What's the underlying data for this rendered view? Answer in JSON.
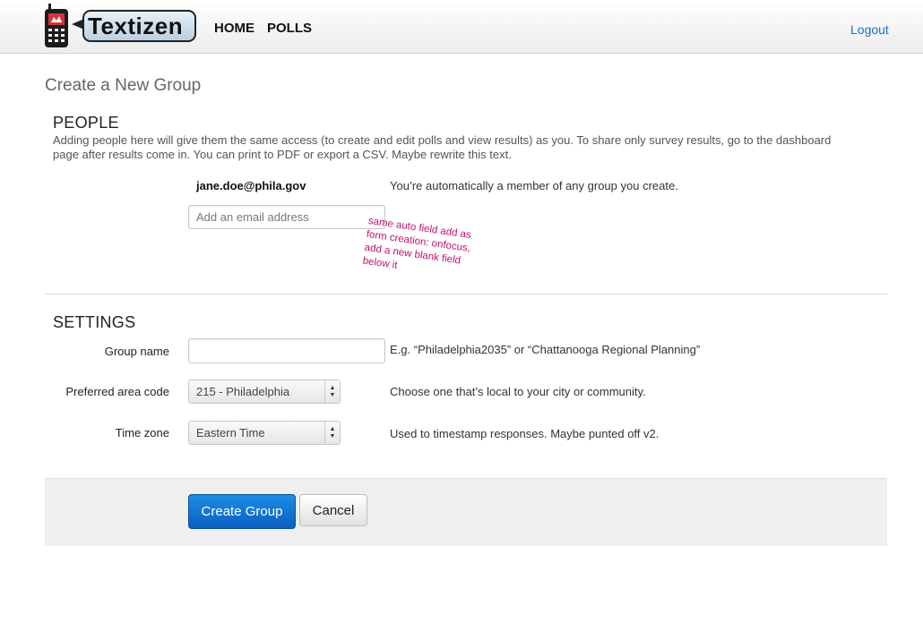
{
  "nav": {
    "brand": "Textizen",
    "home": "HOME",
    "polls": "POLLS",
    "logout": "Logout"
  },
  "page": {
    "title": "Create a New Group"
  },
  "people": {
    "heading": "PEOPLE",
    "intro": "Adding people here will give them the same access (to create and edit polls and view results) as you. To share only survey results, go to the dashboard page after results come in. You can print to PDF or export a CSV. Maybe rewrite this text.",
    "current_user": "jane.doe@phila.gov",
    "current_user_help": "You’re automatically a member of any group you create.",
    "email_placeholder": "Add an email address",
    "annotation": "same auto field add as form creation: onfocus, add a new blank field below it"
  },
  "settings": {
    "heading": "SETTINGS",
    "group_name_label": "Group name",
    "group_name_value": "",
    "group_name_help": "E.g. “Philadelphia2035” or “Chattanooga Regional Planning”",
    "area_code_label": "Preferred area code",
    "area_code_value": "215 - Philadelphia",
    "area_code_help": "Choose one that’s local to your city or community.",
    "timezone_label": "Time zone",
    "timezone_value": "Eastern Time",
    "timezone_help": "Used to timestamp responses. Maybe punted off v2."
  },
  "actions": {
    "create": "Create Group",
    "cancel": "Cancel"
  },
  "icons": {
    "logo": "phone-icon",
    "select_arrows": "select-arrows-icon"
  },
  "colors": {
    "link": "#1a6fc2",
    "primary": "#0b6fd6",
    "annotation": "#c0116d"
  }
}
